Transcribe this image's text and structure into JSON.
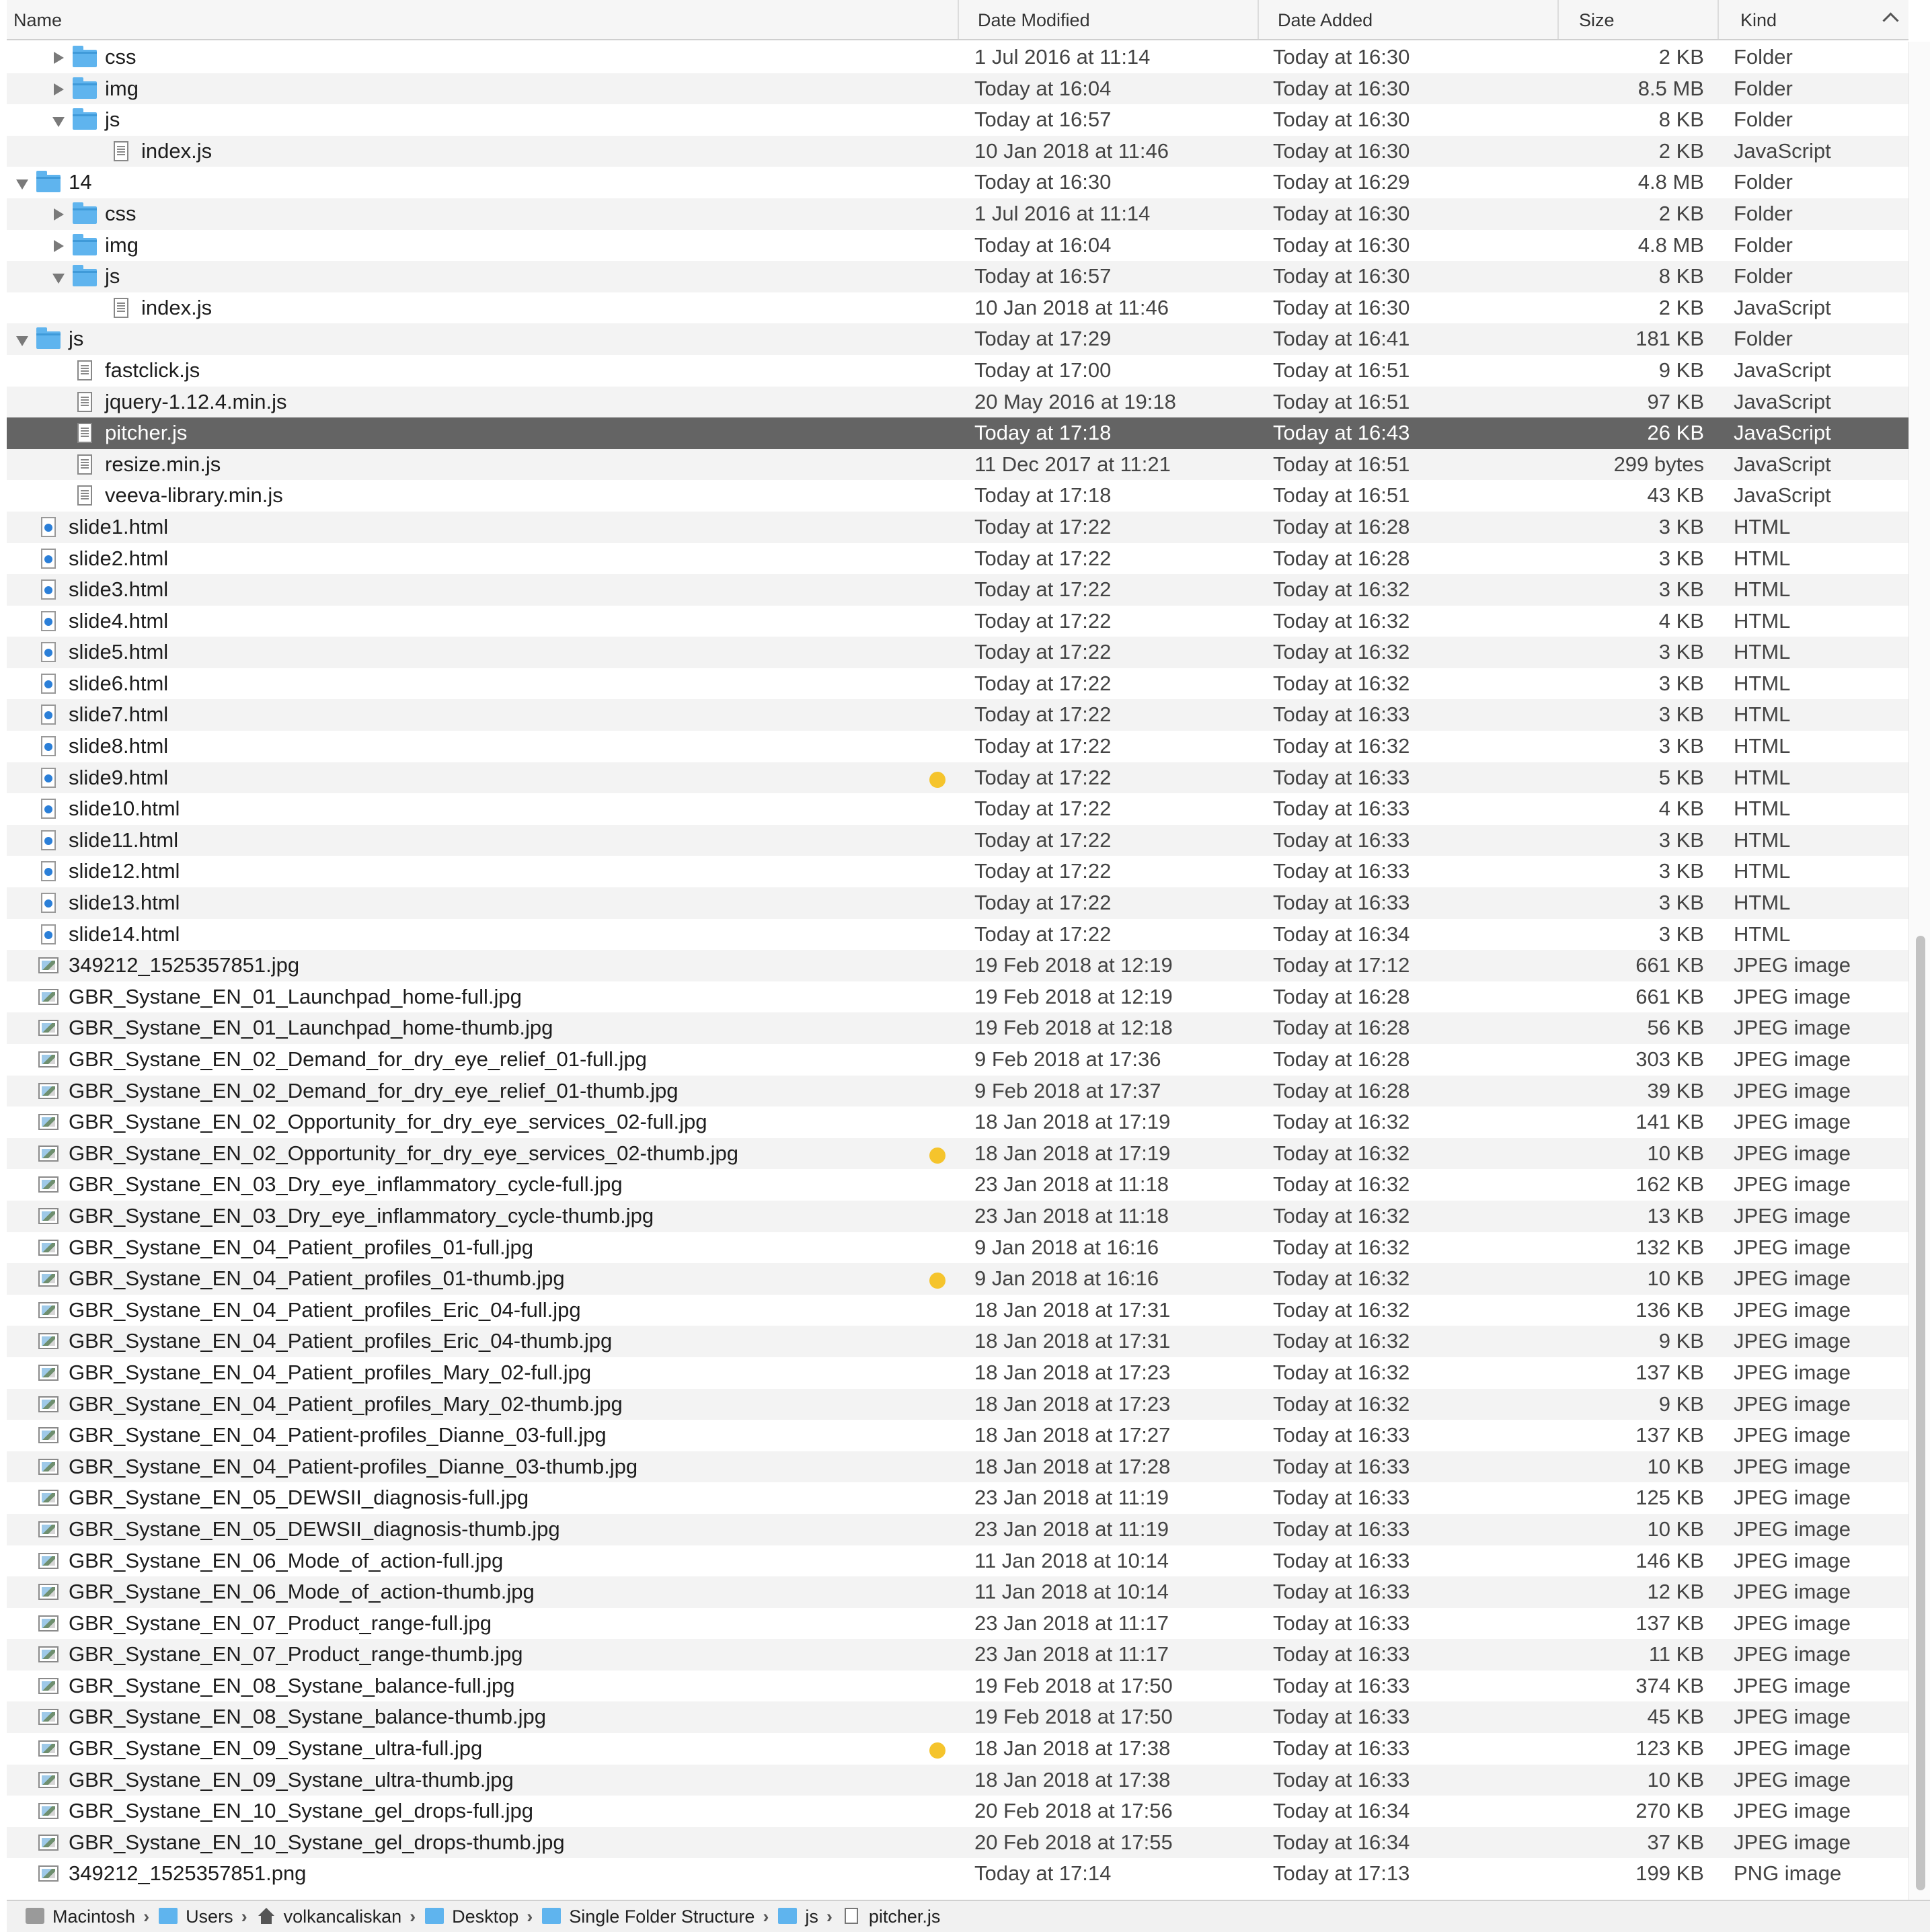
{
  "columns": {
    "name": "Name",
    "date_modified": "Date Modified",
    "date_added": "Date Added",
    "size": "Size",
    "kind": "Kind"
  },
  "rows": [
    {
      "indent": 1,
      "disclosure": "closed",
      "icon": "folder",
      "name": "css",
      "modified": "1 Jul 2016 at 11:14",
      "added": "Today at 16:30",
      "size": "2 KB",
      "kind": "Folder"
    },
    {
      "indent": 1,
      "disclosure": "closed",
      "icon": "folder",
      "name": "img",
      "modified": "Today at 16:04",
      "added": "Today at 16:30",
      "size": "8.5 MB",
      "kind": "Folder"
    },
    {
      "indent": 1,
      "disclosure": "open",
      "icon": "folder",
      "name": "js",
      "modified": "Today at 16:57",
      "added": "Today at 16:30",
      "size": "8 KB",
      "kind": "Folder"
    },
    {
      "indent": 2,
      "disclosure": "none",
      "icon": "js",
      "name": "index.js",
      "modified": "10 Jan 2018 at 11:46",
      "added": "Today at 16:30",
      "size": "2 KB",
      "kind": "JavaScript"
    },
    {
      "indent": 0,
      "disclosure": "open",
      "icon": "folder",
      "name": "14",
      "modified": "Today at 16:30",
      "added": "Today at 16:29",
      "size": "4.8 MB",
      "kind": "Folder"
    },
    {
      "indent": 1,
      "disclosure": "closed",
      "icon": "folder",
      "name": "css",
      "modified": "1 Jul 2016 at 11:14",
      "added": "Today at 16:30",
      "size": "2 KB",
      "kind": "Folder"
    },
    {
      "indent": 1,
      "disclosure": "closed",
      "icon": "folder",
      "name": "img",
      "modified": "Today at 16:04",
      "added": "Today at 16:30",
      "size": "4.8 MB",
      "kind": "Folder"
    },
    {
      "indent": 1,
      "disclosure": "open",
      "icon": "folder",
      "name": "js",
      "modified": "Today at 16:57",
      "added": "Today at 16:30",
      "size": "8 KB",
      "kind": "Folder"
    },
    {
      "indent": 2,
      "disclosure": "none",
      "icon": "js",
      "name": "index.js",
      "modified": "10 Jan 2018 at 11:46",
      "added": "Today at 16:30",
      "size": "2 KB",
      "kind": "JavaScript"
    },
    {
      "indent": 0,
      "disclosure": "open",
      "icon": "folder",
      "name": "js",
      "modified": "Today at 17:29",
      "added": "Today at 16:41",
      "size": "181 KB",
      "kind": "Folder"
    },
    {
      "indent": 1,
      "disclosure": "none",
      "icon": "js",
      "name": "fastclick.js",
      "modified": "Today at 17:00",
      "added": "Today at 16:51",
      "size": "9 KB",
      "kind": "JavaScript"
    },
    {
      "indent": 1,
      "disclosure": "none",
      "icon": "js",
      "name": "jquery-1.12.4.min.js",
      "modified": "20 May 2016 at 19:18",
      "added": "Today at 16:51",
      "size": "97 KB",
      "kind": "JavaScript"
    },
    {
      "indent": 1,
      "disclosure": "none",
      "icon": "js",
      "name": "pitcher.js",
      "modified": "Today at 17:18",
      "added": "Today at 16:43",
      "size": "26 KB",
      "kind": "JavaScript",
      "selected": true
    },
    {
      "indent": 1,
      "disclosure": "none",
      "icon": "js",
      "name": "resize.min.js",
      "modified": "11 Dec 2017 at 11:21",
      "added": "Today at 16:51",
      "size": "299 bytes",
      "kind": "JavaScript"
    },
    {
      "indent": 1,
      "disclosure": "none",
      "icon": "js",
      "name": "veeva-library.min.js",
      "modified": "Today at 17:18",
      "added": "Today at 16:51",
      "size": "43 KB",
      "kind": "JavaScript"
    },
    {
      "indent": 0,
      "disclosure": "none",
      "icon": "html",
      "name": "slide1.html",
      "modified": "Today at 17:22",
      "added": "Today at 16:28",
      "size": "3 KB",
      "kind": "HTML"
    },
    {
      "indent": 0,
      "disclosure": "none",
      "icon": "html",
      "name": "slide2.html",
      "modified": "Today at 17:22",
      "added": "Today at 16:28",
      "size": "3 KB",
      "kind": "HTML"
    },
    {
      "indent": 0,
      "disclosure": "none",
      "icon": "html",
      "name": "slide3.html",
      "modified": "Today at 17:22",
      "added": "Today at 16:32",
      "size": "3 KB",
      "kind": "HTML"
    },
    {
      "indent": 0,
      "disclosure": "none",
      "icon": "html",
      "name": "slide4.html",
      "modified": "Today at 17:22",
      "added": "Today at 16:32",
      "size": "4 KB",
      "kind": "HTML"
    },
    {
      "indent": 0,
      "disclosure": "none",
      "icon": "html",
      "name": "slide5.html",
      "modified": "Today at 17:22",
      "added": "Today at 16:32",
      "size": "3 KB",
      "kind": "HTML"
    },
    {
      "indent": 0,
      "disclosure": "none",
      "icon": "html",
      "name": "slide6.html",
      "modified": "Today at 17:22",
      "added": "Today at 16:32",
      "size": "3 KB",
      "kind": "HTML"
    },
    {
      "indent": 0,
      "disclosure": "none",
      "icon": "html",
      "name": "slide7.html",
      "modified": "Today at 17:22",
      "added": "Today at 16:33",
      "size": "3 KB",
      "kind": "HTML"
    },
    {
      "indent": 0,
      "disclosure": "none",
      "icon": "html",
      "name": "slide8.html",
      "modified": "Today at 17:22",
      "added": "Today at 16:32",
      "size": "3 KB",
      "kind": "HTML"
    },
    {
      "indent": 0,
      "disclosure": "none",
      "icon": "html",
      "name": "slide9.html",
      "modified": "Today at 17:22",
      "added": "Today at 16:33",
      "size": "5 KB",
      "kind": "HTML",
      "tag": "yellow"
    },
    {
      "indent": 0,
      "disclosure": "none",
      "icon": "html",
      "name": "slide10.html",
      "modified": "Today at 17:22",
      "added": "Today at 16:33",
      "size": "4 KB",
      "kind": "HTML"
    },
    {
      "indent": 0,
      "disclosure": "none",
      "icon": "html",
      "name": "slide11.html",
      "modified": "Today at 17:22",
      "added": "Today at 16:33",
      "size": "3 KB",
      "kind": "HTML"
    },
    {
      "indent": 0,
      "disclosure": "none",
      "icon": "html",
      "name": "slide12.html",
      "modified": "Today at 17:22",
      "added": "Today at 16:33",
      "size": "3 KB",
      "kind": "HTML"
    },
    {
      "indent": 0,
      "disclosure": "none",
      "icon": "html",
      "name": "slide13.html",
      "modified": "Today at 17:22",
      "added": "Today at 16:33",
      "size": "3 KB",
      "kind": "HTML"
    },
    {
      "indent": 0,
      "disclosure": "none",
      "icon": "html",
      "name": "slide14.html",
      "modified": "Today at 17:22",
      "added": "Today at 16:34",
      "size": "3 KB",
      "kind": "HTML"
    },
    {
      "indent": 0,
      "disclosure": "none",
      "icon": "img",
      "name": "349212_1525357851.jpg",
      "modified": "19 Feb 2018 at 12:19",
      "added": "Today at 17:12",
      "size": "661 KB",
      "kind": "JPEG image"
    },
    {
      "indent": 0,
      "disclosure": "none",
      "icon": "img",
      "name": "GBR_Systane_EN_01_Launchpad_home-full.jpg",
      "modified": "19 Feb 2018 at 12:19",
      "added": "Today at 16:28",
      "size": "661 KB",
      "kind": "JPEG image"
    },
    {
      "indent": 0,
      "disclosure": "none",
      "icon": "img",
      "name": "GBR_Systane_EN_01_Launchpad_home-thumb.jpg",
      "modified": "19 Feb 2018 at 12:18",
      "added": "Today at 16:28",
      "size": "56 KB",
      "kind": "JPEG image"
    },
    {
      "indent": 0,
      "disclosure": "none",
      "icon": "img",
      "name": "GBR_Systane_EN_02_Demand_for_dry_eye_relief_01-full.jpg",
      "modified": "9 Feb 2018 at 17:36",
      "added": "Today at 16:28",
      "size": "303 KB",
      "kind": "JPEG image"
    },
    {
      "indent": 0,
      "disclosure": "none",
      "icon": "img",
      "name": "GBR_Systane_EN_02_Demand_for_dry_eye_relief_01-thumb.jpg",
      "modified": "9 Feb 2018 at 17:37",
      "added": "Today at 16:28",
      "size": "39 KB",
      "kind": "JPEG image"
    },
    {
      "indent": 0,
      "disclosure": "none",
      "icon": "img",
      "name": "GBR_Systane_EN_02_Opportunity_for_dry_eye_services_02-full.jpg",
      "modified": "18 Jan 2018 at 17:19",
      "added": "Today at 16:32",
      "size": "141 KB",
      "kind": "JPEG image"
    },
    {
      "indent": 0,
      "disclosure": "none",
      "icon": "img",
      "name": "GBR_Systane_EN_02_Opportunity_for_dry_eye_services_02-thumb.jpg",
      "modified": "18 Jan 2018 at 17:19",
      "added": "Today at 16:32",
      "size": "10 KB",
      "kind": "JPEG image",
      "tag": "yellow"
    },
    {
      "indent": 0,
      "disclosure": "none",
      "icon": "img",
      "name": "GBR_Systane_EN_03_Dry_eye_inflammatory_cycle-full.jpg",
      "modified": "23 Jan 2018 at 11:18",
      "added": "Today at 16:32",
      "size": "162 KB",
      "kind": "JPEG image"
    },
    {
      "indent": 0,
      "disclosure": "none",
      "icon": "img",
      "name": "GBR_Systane_EN_03_Dry_eye_inflammatory_cycle-thumb.jpg",
      "modified": "23 Jan 2018 at 11:18",
      "added": "Today at 16:32",
      "size": "13 KB",
      "kind": "JPEG image"
    },
    {
      "indent": 0,
      "disclosure": "none",
      "icon": "img",
      "name": "GBR_Systane_EN_04_Patient_profiles_01-full.jpg",
      "modified": "9 Jan 2018 at 16:16",
      "added": "Today at 16:32",
      "size": "132 KB",
      "kind": "JPEG image"
    },
    {
      "indent": 0,
      "disclosure": "none",
      "icon": "img",
      "name": "GBR_Systane_EN_04_Patient_profiles_01-thumb.jpg",
      "modified": "9 Jan 2018 at 16:16",
      "added": "Today at 16:32",
      "size": "10 KB",
      "kind": "JPEG image",
      "tag": "yellow"
    },
    {
      "indent": 0,
      "disclosure": "none",
      "icon": "img",
      "name": "GBR_Systane_EN_04_Patient_profiles_Eric_04-full.jpg",
      "modified": "18 Jan 2018 at 17:31",
      "added": "Today at 16:32",
      "size": "136 KB",
      "kind": "JPEG image"
    },
    {
      "indent": 0,
      "disclosure": "none",
      "icon": "img",
      "name": "GBR_Systane_EN_04_Patient_profiles_Eric_04-thumb.jpg",
      "modified": "18 Jan 2018 at 17:31",
      "added": "Today at 16:32",
      "size": "9 KB",
      "kind": "JPEG image"
    },
    {
      "indent": 0,
      "disclosure": "none",
      "icon": "img",
      "name": "GBR_Systane_EN_04_Patient_profiles_Mary_02-full.jpg",
      "modified": "18 Jan 2018 at 17:23",
      "added": "Today at 16:32",
      "size": "137 KB",
      "kind": "JPEG image"
    },
    {
      "indent": 0,
      "disclosure": "none",
      "icon": "img",
      "name": "GBR_Systane_EN_04_Patient_profiles_Mary_02-thumb.jpg",
      "modified": "18 Jan 2018 at 17:23",
      "added": "Today at 16:32",
      "size": "9 KB",
      "kind": "JPEG image"
    },
    {
      "indent": 0,
      "disclosure": "none",
      "icon": "img",
      "name": "GBR_Systane_EN_04_Patient-profiles_Dianne_03-full.jpg",
      "modified": "18 Jan 2018 at 17:27",
      "added": "Today at 16:33",
      "size": "137 KB",
      "kind": "JPEG image"
    },
    {
      "indent": 0,
      "disclosure": "none",
      "icon": "img",
      "name": "GBR_Systane_EN_04_Patient-profiles_Dianne_03-thumb.jpg",
      "modified": "18 Jan 2018 at 17:28",
      "added": "Today at 16:33",
      "size": "10 KB",
      "kind": "JPEG image"
    },
    {
      "indent": 0,
      "disclosure": "none",
      "icon": "img",
      "name": "GBR_Systane_EN_05_DEWSII_diagnosis-full.jpg",
      "modified": "23 Jan 2018 at 11:19",
      "added": "Today at 16:33",
      "size": "125 KB",
      "kind": "JPEG image"
    },
    {
      "indent": 0,
      "disclosure": "none",
      "icon": "img",
      "name": "GBR_Systane_EN_05_DEWSII_diagnosis-thumb.jpg",
      "modified": "23 Jan 2018 at 11:19",
      "added": "Today at 16:33",
      "size": "10 KB",
      "kind": "JPEG image"
    },
    {
      "indent": 0,
      "disclosure": "none",
      "icon": "img",
      "name": "GBR_Systane_EN_06_Mode_of_action-full.jpg",
      "modified": "11 Jan 2018 at 10:14",
      "added": "Today at 16:33",
      "size": "146 KB",
      "kind": "JPEG image"
    },
    {
      "indent": 0,
      "disclosure": "none",
      "icon": "img",
      "name": "GBR_Systane_EN_06_Mode_of_action-thumb.jpg",
      "modified": "11 Jan 2018 at 10:14",
      "added": "Today at 16:33",
      "size": "12 KB",
      "kind": "JPEG image"
    },
    {
      "indent": 0,
      "disclosure": "none",
      "icon": "img",
      "name": "GBR_Systane_EN_07_Product_range-full.jpg",
      "modified": "23 Jan 2018 at 11:17",
      "added": "Today at 16:33",
      "size": "137 KB",
      "kind": "JPEG image"
    },
    {
      "indent": 0,
      "disclosure": "none",
      "icon": "img",
      "name": "GBR_Systane_EN_07_Product_range-thumb.jpg",
      "modified": "23 Jan 2018 at 11:17",
      "added": "Today at 16:33",
      "size": "11 KB",
      "kind": "JPEG image"
    },
    {
      "indent": 0,
      "disclosure": "none",
      "icon": "img",
      "name": "GBR_Systane_EN_08_Systane_balance-full.jpg",
      "modified": "19 Feb 2018 at 17:50",
      "added": "Today at 16:33",
      "size": "374 KB",
      "kind": "JPEG image"
    },
    {
      "indent": 0,
      "disclosure": "none",
      "icon": "img",
      "name": "GBR_Systane_EN_08_Systane_balance-thumb.jpg",
      "modified": "19 Feb 2018 at 17:50",
      "added": "Today at 16:33",
      "size": "45 KB",
      "kind": "JPEG image"
    },
    {
      "indent": 0,
      "disclosure": "none",
      "icon": "img",
      "name": "GBR_Systane_EN_09_Systane_ultra-full.jpg",
      "modified": "18 Jan 2018 at 17:38",
      "added": "Today at 16:33",
      "size": "123 KB",
      "kind": "JPEG image",
      "tag": "yellow"
    },
    {
      "indent": 0,
      "disclosure": "none",
      "icon": "img",
      "name": "GBR_Systane_EN_09_Systane_ultra-thumb.jpg",
      "modified": "18 Jan 2018 at 17:38",
      "added": "Today at 16:33",
      "size": "10 KB",
      "kind": "JPEG image"
    },
    {
      "indent": 0,
      "disclosure": "none",
      "icon": "img",
      "name": "GBR_Systane_EN_10_Systane_gel_drops-full.jpg",
      "modified": "20 Feb 2018 at 17:56",
      "added": "Today at 16:34",
      "size": "270 KB",
      "kind": "JPEG image"
    },
    {
      "indent": 0,
      "disclosure": "none",
      "icon": "img",
      "name": "GBR_Systane_EN_10_Systane_gel_drops-thumb.jpg",
      "modified": "20 Feb 2018 at 17:55",
      "added": "Today at 16:34",
      "size": "37 KB",
      "kind": "JPEG image"
    },
    {
      "indent": 0,
      "disclosure": "none",
      "icon": "img",
      "name": "349212_1525357851.png",
      "modified": "Today at 17:14",
      "added": "Today at 17:13",
      "size": "199 KB",
      "kind": "PNG image"
    }
  ],
  "path_bar": [
    {
      "icon": "disk",
      "label": "Macintosh"
    },
    {
      "icon": "fold",
      "label": "Users"
    },
    {
      "icon": "home",
      "label": "volkancaliskan"
    },
    {
      "icon": "fold",
      "label": "Desktop"
    },
    {
      "icon": "fold",
      "label": "Single Folder Structure"
    },
    {
      "icon": "fold",
      "label": "js"
    },
    {
      "icon": "file",
      "label": "pitcher.js"
    }
  ],
  "colors": {
    "selection": "#646464",
    "folder": "#5fb4ee",
    "tag_yellow": "#f5c42c"
  }
}
